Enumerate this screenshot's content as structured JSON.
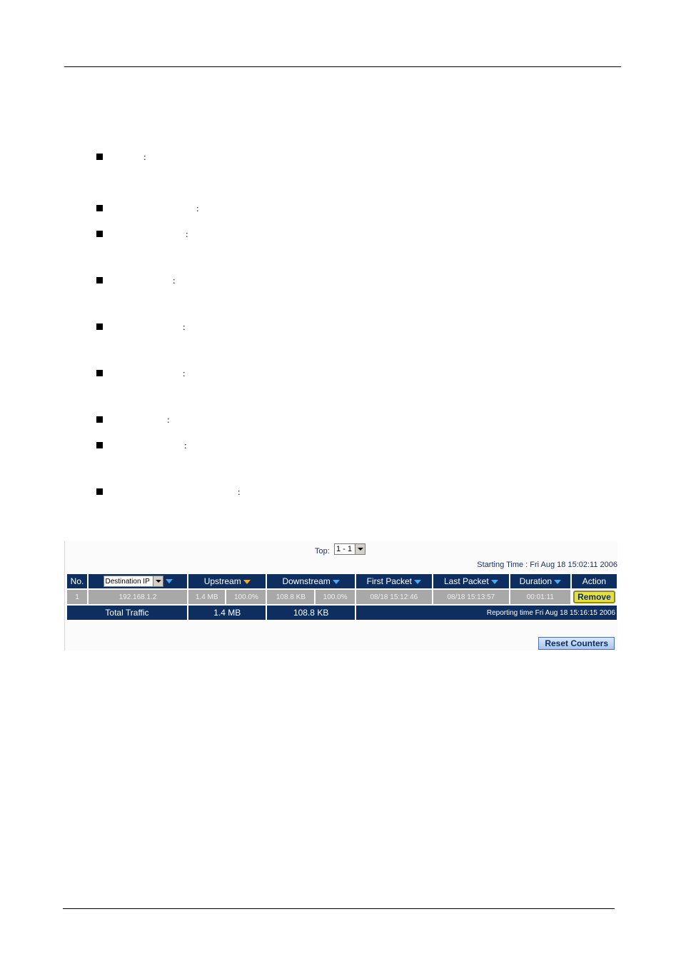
{
  "bullets": [
    {
      "marker": "■",
      "separator": ":"
    },
    {
      "marker": "■",
      "separator": ":"
    },
    {
      "marker": "■",
      "separator": ":"
    },
    {
      "marker": "■",
      "separator": ":"
    },
    {
      "marker": "■",
      "separator": ":"
    },
    {
      "marker": "■",
      "separator": ":"
    },
    {
      "marker": "■",
      "separator": ":"
    },
    {
      "marker": "■",
      "separator": ":"
    },
    {
      "marker": "■",
      "separator": ":"
    }
  ],
  "panel": {
    "top_label": "Top:",
    "top_value": "1 - 1",
    "starting_time": "Starting Time : Fri Aug 18 15:02:11 2006",
    "headers": {
      "no": "No.",
      "dest_select": "Destination IP",
      "upstream": "Upstream",
      "downstream": "Downstream",
      "first_packet": "First Packet",
      "last_packet": "Last Packet",
      "duration": "Duration",
      "action": "Action"
    },
    "rows": [
      {
        "no": "1",
        "ip": "192.168.1.2",
        "up": "1.4 MB",
        "up_pct": "100.0%",
        "down": "108.8 KB",
        "down_pct": "100.0%",
        "first": "08/18 15:12:46",
        "last": "08/18 15:13:57",
        "duration": "00:01:11",
        "action": "Remove"
      }
    ],
    "total": {
      "label": "Total Traffic",
      "up": "1.4 MB",
      "down": "108.8 KB",
      "reporting": "Reporting time Fri Aug 18 15:16:15 2006"
    },
    "reset_button": "Reset Counters",
    "colors": {
      "header_bg": "#0d2e5e",
      "row_bg": "#a8a8a8",
      "sort_active": "#f0a830",
      "sort_inactive": "#4aa8f0"
    }
  }
}
